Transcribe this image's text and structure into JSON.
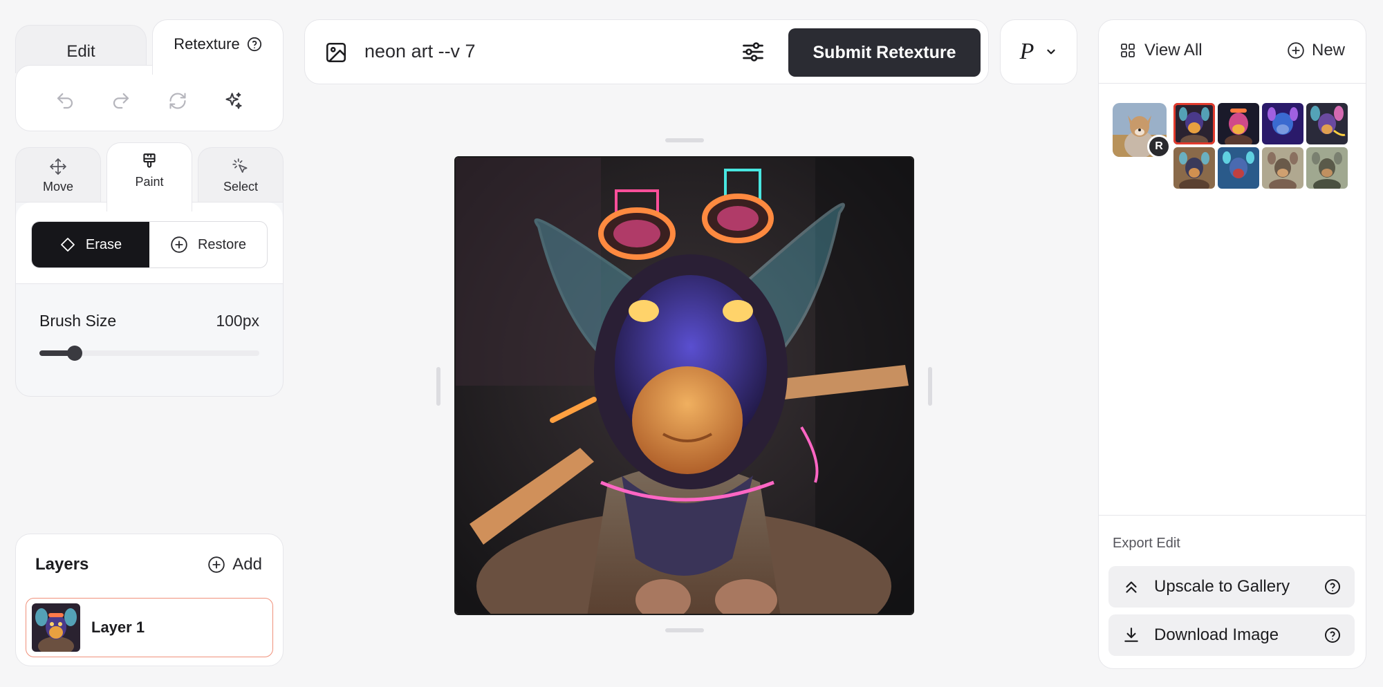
{
  "mode_tabs": {
    "edit_label": "Edit",
    "retexture_label": "Retexture"
  },
  "tools": {
    "move_label": "Move",
    "paint_label": "Paint",
    "select_label": "Select"
  },
  "paint": {
    "erase_label": "Erase",
    "restore_label": "Restore",
    "brush_size_label": "Brush Size",
    "brush_size_value": "100px",
    "brush_size_fraction": 0.16
  },
  "layers": {
    "title": "Layers",
    "add_label": "Add",
    "items": [
      {
        "name": "Layer 1"
      }
    ]
  },
  "prompt": {
    "text": "neon art --v 7",
    "submit_label": "Submit Retexture"
  },
  "model": {
    "letter": "P"
  },
  "gallery": {
    "view_all_label": "View All",
    "new_label": "New",
    "original_badge": "R"
  },
  "export": {
    "section_label": "Export Edit",
    "upscale_label": "Upscale to Gallery",
    "download_label": "Download Image"
  },
  "colors": {
    "accent_dark": "#16161a",
    "submit_bg": "#2b2c33",
    "selected_outline": "#e23b2e",
    "layer_border": "#f0907a"
  }
}
